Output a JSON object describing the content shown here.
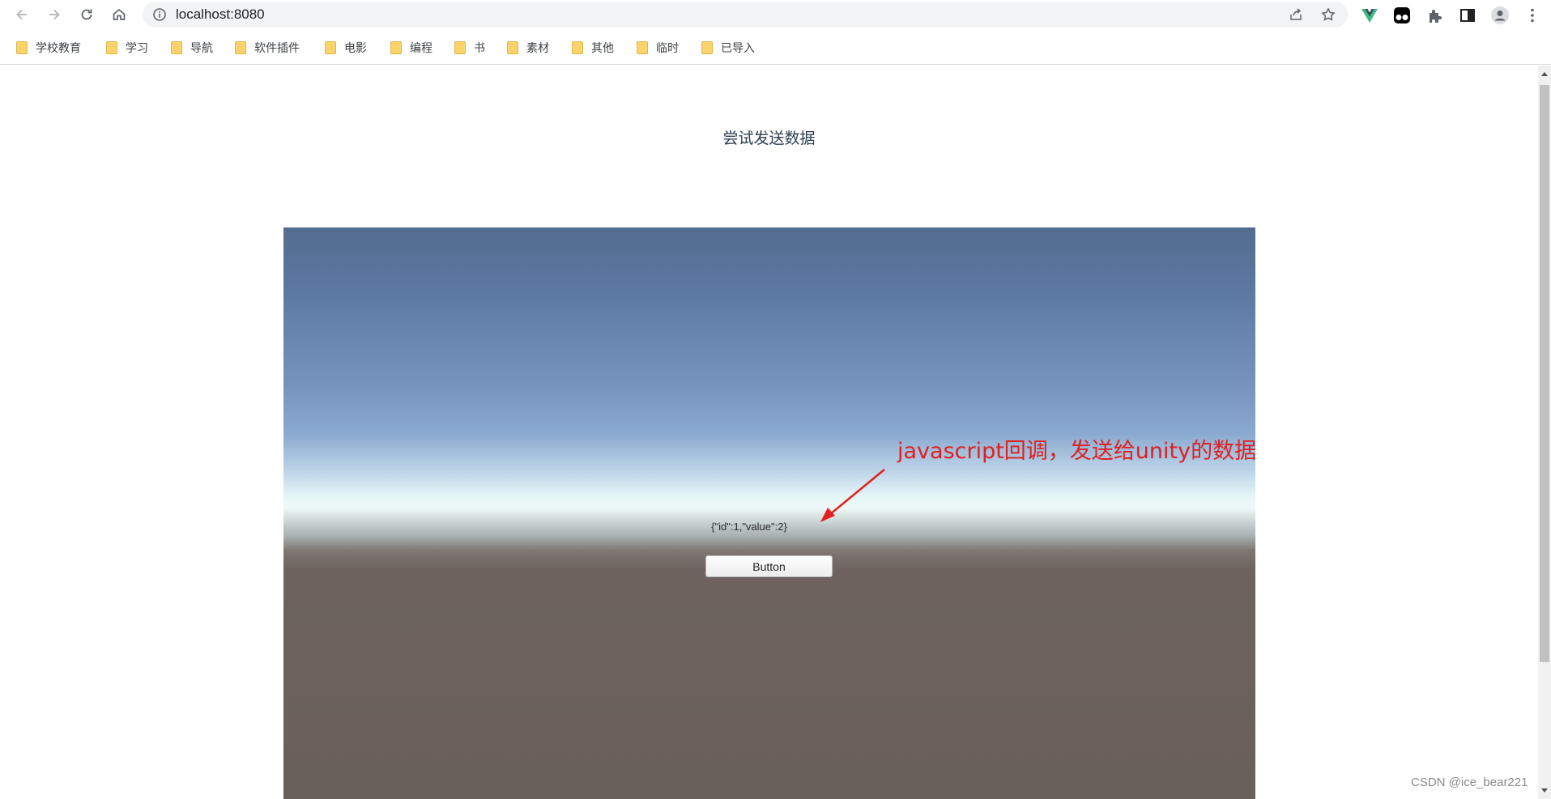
{
  "browser": {
    "url": "localhost:8080",
    "icons": {
      "back": "back-arrow-icon",
      "forward": "forward-arrow-icon",
      "reload": "reload-icon",
      "home": "home-icon",
      "site_info": "info-icon",
      "share": "share-icon",
      "bookmark": "star-icon",
      "vue_devtools": "vue-icon",
      "tampermonkey": "tampermonkey-icon",
      "extensions": "puzzle-icon",
      "side_panel": "side-panel-icon",
      "profile": "profile-icon",
      "menu": "kebab-menu-icon"
    }
  },
  "bookmarks": [
    {
      "label": "学校教育"
    },
    {
      "label": "学习"
    },
    {
      "label": "导航"
    },
    {
      "label": "软件插件"
    },
    {
      "label": "电影"
    },
    {
      "label": "编程"
    },
    {
      "label": "书"
    },
    {
      "label": "素材"
    },
    {
      "label": "其他"
    },
    {
      "label": "临时"
    },
    {
      "label": "已导入"
    }
  ],
  "page": {
    "title": "尝试发送数据",
    "unity": {
      "json_text": "{\"id\":1,\"value\":2}",
      "button_label": "Button"
    },
    "annotation": "javascript回调，发送给unity的数据"
  },
  "watermark": "CSDN @ice_bear221",
  "colors": {
    "annotation": "#e02020",
    "title": "#2c3e50",
    "sky_top": "#546c8f",
    "ground": "#6a605b"
  }
}
